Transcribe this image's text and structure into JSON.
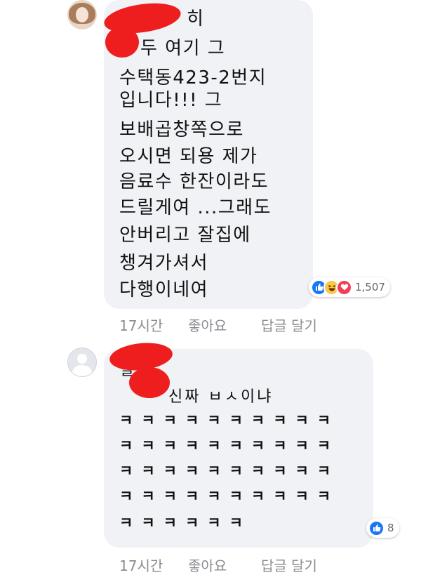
{
  "comments": [
    {
      "lines": [
        "히",
        "두 여기 그",
        "수택동423-2번지",
        "입니다!!! 그",
        "보배곱창쪽으로",
        "오시면 되용 제가",
        "음료수 한잔이라도",
        "드릴게여 ...그래도",
        "안버리고 잘집에",
        "챙겨가셔서",
        "다행이네여"
      ],
      "reaction_count": "1,507",
      "time": "17시간",
      "like_label": "좋아요",
      "reply_label": "답글 달기"
    },
    {
      "lines": [
        "헐",
        "신짜 ㅂㅅ이냐"
      ],
      "kk_rows": [
        "ㅋㅋㅋㅋㅋㅋㅋㅋㅋㅋ",
        "ㅋㅋㅋㅋㅋㅋㅋㅋㅋㅋ",
        "ㅋㅋㅋㅋㅋㅋㅋㅋㅋㅋ",
        "ㅋㅋㅋㅋㅋㅋㅋㅋㅋㅋ",
        "ㅋㅋㅋㅋㅋㅋ"
      ],
      "reaction_count": "8",
      "time": "17시간",
      "like_label": "좋아요",
      "reply_label": "답글 달기"
    }
  ],
  "icons": {
    "like": "like-reaction-icon",
    "haha": "haha-reaction-icon",
    "love": "love-reaction-icon",
    "avatar": "default-avatar-icon"
  },
  "colors": {
    "bubble": "#f0f2f5",
    "like": "#1877f2",
    "haha": "#f7c84a",
    "love": "#f33e58",
    "redaction": "#ee1e1e",
    "meta_text": "#8a8d91"
  }
}
